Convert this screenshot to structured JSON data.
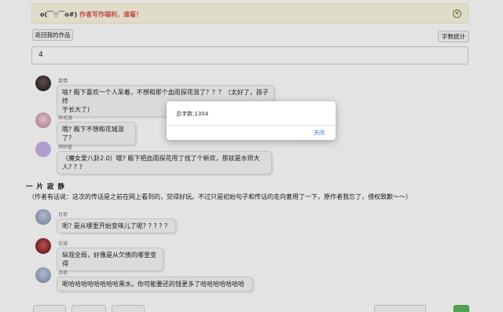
{
  "notice": {
    "emoticon": "o(￣▽￣o#)",
    "message": "作者写作福利，速看！"
  },
  "toolbar": {
    "back_label": "返回我的作品",
    "stats_label": "字数统计"
  },
  "count_input": {
    "value": "4"
  },
  "messages_top": [
    {
      "name": "慕情",
      "text_line1": "啥? 殿下喜欢一个人呆着，不想和那个血雨探花混了？？？（太好了，孩子终",
      "text_line2": "于长大了)"
    },
    {
      "name": "师无渡",
      "text_line1": "哦? 殿下不想和花城混了?"
    },
    {
      "name": "雨师篁",
      "text_line1": "（魔女爱八卦2.0）哦? 殿下把血雨探花甩了找了个新欢，那就是水师大",
      "text_line2": "人? ? ?"
    }
  ],
  "section_title": "一 片 寂 静",
  "author_note": "（作者有话说：这次的传话是之前在网上看到的，觉得好玩。不过只是初始句子和传话的走向套用了一下，原作者我忘了，侵权致歉～～）",
  "messages_bottom": [
    {
      "name": "月荷",
      "text": "呃? 是从哪里开始变味儿了呢? ? ? ? ?"
    },
    {
      "name": "花城",
      "text": "纵观全局，好像是从欠债的哪里变得"
    },
    {
      "name": "月荷",
      "text": "哐哈哈哈哈哈哈哈哈黑水。你可能要还的钱更多了哈哈哈哈哈哈哈"
    }
  ],
  "modal": {
    "count_text": "总字数:1304",
    "close_label": "关闭"
  },
  "colors": {
    "accent_link": "#2f7fd6",
    "notice_text": "#d9534f",
    "notice_bg": "#fcf8e3"
  }
}
